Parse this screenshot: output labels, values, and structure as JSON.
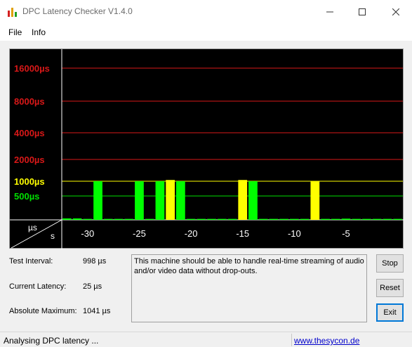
{
  "window": {
    "title": "DPC Latency Checker V1.4.0",
    "icon": "bar-chart-app-icon"
  },
  "menu": {
    "items": [
      {
        "label": "File"
      },
      {
        "label": "Info"
      }
    ]
  },
  "chart": {
    "axis_corner_top": "µs",
    "axis_corner_bottom": "s"
  },
  "chart_data": {
    "type": "bar",
    "xlabel": "s",
    "ylabel": "µs",
    "y_tick_labels": [
      "16000µs",
      "8000µs",
      "4000µs",
      "2000µs",
      "1000µs",
      "500µs"
    ],
    "y_tick_colors": [
      "#d81818",
      "#d81818",
      "#d81818",
      "#d81818",
      "#ffff00",
      "#00e000"
    ],
    "x_tick_labels": [
      "-30",
      "-25",
      "-20",
      "-15",
      "-10",
      "-5"
    ],
    "x_tick_values": [
      -30,
      -25,
      -20,
      -15,
      -10,
      -5
    ],
    "x_range": [
      -32,
      0
    ],
    "status_colors": {
      "green": "#00ff00",
      "yellow": "#ffff00"
    },
    "bars": [
      {
        "t": -32,
        "value": 30,
        "status": "green"
      },
      {
        "t": -31,
        "value": 30,
        "status": "green"
      },
      {
        "t": -30,
        "value": 20,
        "status": "green"
      },
      {
        "t": -29,
        "value": 1000,
        "status": "green"
      },
      {
        "t": -28,
        "value": 20,
        "status": "green"
      },
      {
        "t": -27,
        "value": 20,
        "status": "green"
      },
      {
        "t": -26,
        "value": 20,
        "status": "green"
      },
      {
        "t": -25,
        "value": 1000,
        "status": "green"
      },
      {
        "t": -24,
        "value": 20,
        "status": "green"
      },
      {
        "t": -23,
        "value": 1000,
        "status": "green"
      },
      {
        "t": -22,
        "value": 1041,
        "status": "yellow"
      },
      {
        "t": -21,
        "value": 1000,
        "status": "green"
      },
      {
        "t": -20,
        "value": 20,
        "status": "green"
      },
      {
        "t": -19,
        "value": 20,
        "status": "green"
      },
      {
        "t": -18,
        "value": 20,
        "status": "green"
      },
      {
        "t": -17,
        "value": 20,
        "status": "green"
      },
      {
        "t": -16,
        "value": 20,
        "status": "green"
      },
      {
        "t": -15,
        "value": 1041,
        "status": "yellow"
      },
      {
        "t": -14,
        "value": 1000,
        "status": "green"
      },
      {
        "t": -13,
        "value": 20,
        "status": "green"
      },
      {
        "t": -12,
        "value": 20,
        "status": "green"
      },
      {
        "t": -11,
        "value": 20,
        "status": "green"
      },
      {
        "t": -10,
        "value": 20,
        "status": "green"
      },
      {
        "t": -9,
        "value": 20,
        "status": "green"
      },
      {
        "t": -8,
        "value": 1000,
        "status": "yellow"
      },
      {
        "t": -7,
        "value": 20,
        "status": "green"
      },
      {
        "t": -6,
        "value": 20,
        "status": "green"
      },
      {
        "t": -5,
        "value": 25,
        "status": "green"
      },
      {
        "t": -4,
        "value": 20,
        "status": "green"
      },
      {
        "t": -3,
        "value": 20,
        "status": "green"
      },
      {
        "t": -2,
        "value": 20,
        "status": "green"
      },
      {
        "t": -1,
        "value": 20,
        "status": "green"
      },
      {
        "t": 0,
        "value": 20,
        "status": "green"
      }
    ]
  },
  "stats": {
    "test_interval_label": "Test Interval:",
    "test_interval_value": "998 µs",
    "current_latency_label": "Current Latency:",
    "current_latency_value": "25 µs",
    "absolute_max_label": "Absolute Maximum:",
    "absolute_max_value": "1041 µs"
  },
  "message": "This machine should be able to handle real-time streaming of audio and/or video data without drop-outs.",
  "buttons": {
    "stop": "Stop",
    "reset": "Reset",
    "exit": "Exit"
  },
  "status": {
    "text": "Analysing DPC latency ...",
    "link": "www.thesycon.de"
  }
}
